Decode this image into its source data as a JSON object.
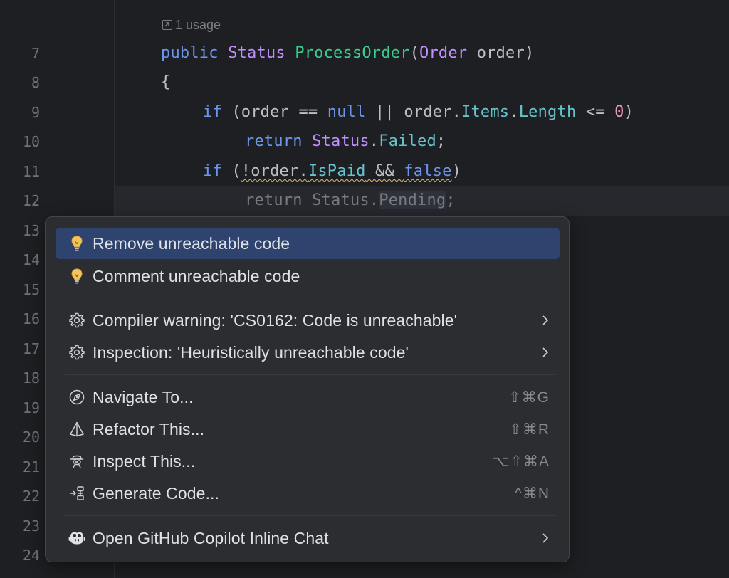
{
  "editor": {
    "usage_hint": "1 usage",
    "line_numbers": [
      "7",
      "8",
      "9",
      "10",
      "11",
      "12",
      "13",
      "14",
      "15",
      "16",
      "17",
      "18",
      "19",
      "20",
      "21",
      "22",
      "23",
      "24"
    ],
    "code": {
      "l7": {
        "kw_public": "public",
        "type_status": "Status",
        "method": "ProcessOrder",
        "paren_open": "(",
        "type_order": "Order",
        "param": " order",
        "paren_close": ")"
      },
      "l8": {
        "brace": "{"
      },
      "l9": {
        "kw_if": "if",
        "p1": " (order == ",
        "kw_null": "null",
        "p2": " || order.",
        "prop_items": "Items",
        "dot": ".",
        "prop_length": "Length",
        "p3": " <= ",
        "num": "0",
        "p4": ")"
      },
      "l10": {
        "kw_return": "return",
        "sp": " ",
        "type_status": "Status",
        "dot": ".",
        "prop_failed": "Failed",
        "semi": ";"
      },
      "l11": {
        "kw_if": "if",
        "p1": " (",
        "sq1": "!order.",
        "prop_ispaid": "IsPaid",
        "sq2": " && ",
        "kw_false": "false",
        "p2": ")"
      },
      "l12": {
        "text": "return Status.",
        "sel": "Pending",
        "semi": ";"
      }
    }
  },
  "popup": {
    "items": [
      {
        "label": "Remove unreachable code",
        "icon": "lightbulb-icon",
        "selected": true
      },
      {
        "label": "Comment unreachable code",
        "icon": "lightbulb-icon"
      },
      {
        "label": "Compiler warning: 'CS0162: Code is unreachable'",
        "icon": "gear-icon",
        "submenu": true
      },
      {
        "label": "Inspection: 'Heuristically unreachable code'",
        "icon": "gear-icon",
        "submenu": true
      },
      {
        "label": "Navigate To...",
        "icon": "compass-icon",
        "shortcut": "⇧⌘G"
      },
      {
        "label": "Refactor This...",
        "icon": "prism-icon",
        "shortcut": "⇧⌘R"
      },
      {
        "label": "Inspect This...",
        "icon": "inspector-icon",
        "shortcut": "⌥⇧⌘A"
      },
      {
        "label": "Generate Code...",
        "icon": "generate-icon",
        "shortcut": "^⌘N"
      },
      {
        "label": "Open GitHub Copilot Inline Chat",
        "icon": "copilot-icon",
        "submenu": true
      }
    ]
  },
  "colors": {
    "background": "#1e1f22",
    "popup_background": "#2b2d30",
    "selection": "#2e436e",
    "keyword": "#6c95eb",
    "type": "#c191ff",
    "method": "#39cc8f",
    "property": "#66c3cc",
    "number": "#ed94c0",
    "warning": "#d5b778"
  }
}
